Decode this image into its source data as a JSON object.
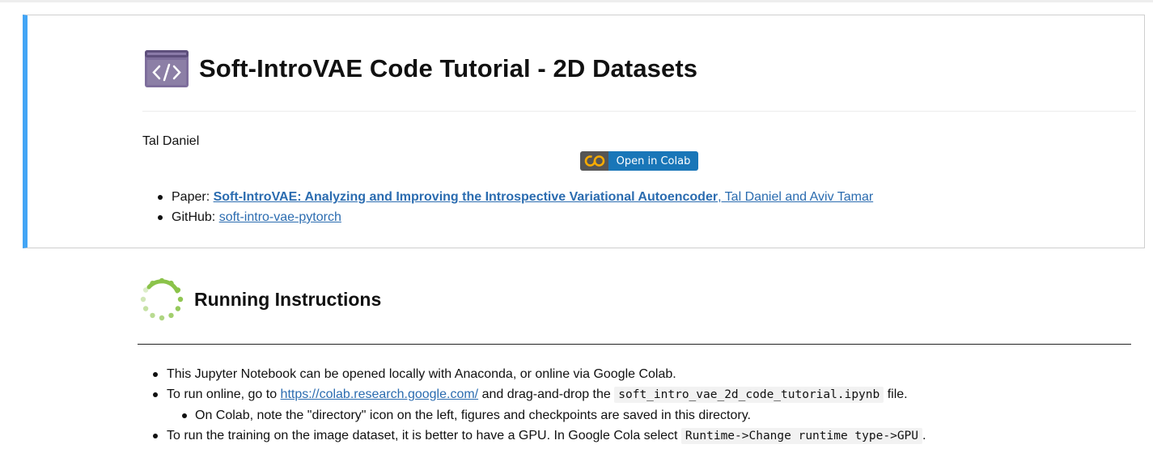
{
  "header_cell": {
    "title": "Soft-IntroVAE Code Tutorial - 2D Datasets",
    "title_icon": "code-window-icon",
    "author": "Tal Daniel",
    "colab_badge": {
      "logo_text": "CO",
      "label": "Open in Colab"
    },
    "links": [
      {
        "prefix": "Paper: ",
        "link_text": "Soft-IntroVAE: Analyzing and Improving the Introspective Variational Autoencoder",
        "suffix": ", Tal Daniel and Aviv Tamar"
      },
      {
        "prefix": "GitHub: ",
        "link_text": "soft-intro-vae-pytorch"
      }
    ]
  },
  "instructions_cell": {
    "title": "Running Instructions",
    "title_icon": "loading-spinner-icon",
    "items": [
      {
        "text": "This Jupyter Notebook can be opened locally with Anaconda, or online via Google Colab."
      },
      {
        "before": "To run online, go to ",
        "link": "https://colab.research.google.com/",
        "middle": " and drag-and-drop the ",
        "code": "soft_intro_vae_2d_code_tutorial.ipynb",
        "after": " file."
      },
      {
        "sub_text": "On Colab, note the \"directory\" icon on the left, figures and checkpoints are saved in this directory."
      },
      {
        "before": "To run the training on the image dataset, it is better to have a GPU. In Google Cola select ",
        "code": "Runtime->Change runtime type->GPU",
        "after": "."
      }
    ]
  },
  "colors": {
    "selected_cell_border": "#42a5f5",
    "link": "#2b6cb0",
    "badge_blue": "#1976b8",
    "badge_gray": "#555555",
    "colab_orange": "#f9ab00",
    "spinner_green": "#8bc34a"
  }
}
